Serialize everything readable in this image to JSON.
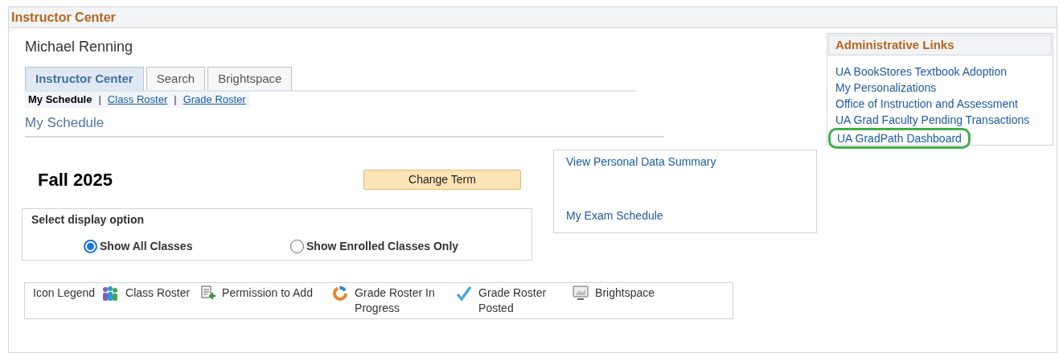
{
  "page_title": "Instructor Center",
  "user_name": "Michael Renning",
  "tabs": [
    {
      "label": "Instructor Center",
      "selected": true
    },
    {
      "label": "Search",
      "selected": false
    },
    {
      "label": "Brightspace",
      "selected": false
    }
  ],
  "subnav": [
    {
      "label": "My Schedule",
      "selected": true
    },
    {
      "label": "Class Roster",
      "selected": false
    },
    {
      "label": "Grade Roster",
      "selected": false
    }
  ],
  "subnav_separator": "|",
  "section_title": "My Schedule",
  "term": "Fall 2025",
  "change_term_button": "Change Term",
  "quick_links": [
    "View Personal Data Summary",
    "My Exam Schedule"
  ],
  "display_option": {
    "title": "Select display option",
    "options": [
      {
        "label": "Show All Classes",
        "selected": true
      },
      {
        "label": "Show Enrolled Classes Only",
        "selected": false
      }
    ]
  },
  "icon_legend": {
    "title": "Icon Legend",
    "items": [
      {
        "kind": "roster",
        "label": "Class Roster"
      },
      {
        "kind": "permission",
        "label": "Permission to Add"
      },
      {
        "kind": "progress",
        "label": "Grade Roster In Progress"
      },
      {
        "kind": "posted",
        "label": "Grade Roster Posted"
      },
      {
        "kind": "brightspace",
        "label": "Brightspace"
      }
    ]
  },
  "admin_links": {
    "title": "Administrative Links",
    "links": [
      {
        "label": "UA BookStores Textbook Adoption",
        "highlighted": false
      },
      {
        "label": "My Personalizations",
        "highlighted": false
      },
      {
        "label": "Office of Instruction and Assessment",
        "highlighted": false
      },
      {
        "label": "UA Grad Faculty Pending Transactions",
        "highlighted": false
      },
      {
        "label": "UA GradPath Dashboard",
        "highlighted": true
      }
    ]
  }
}
